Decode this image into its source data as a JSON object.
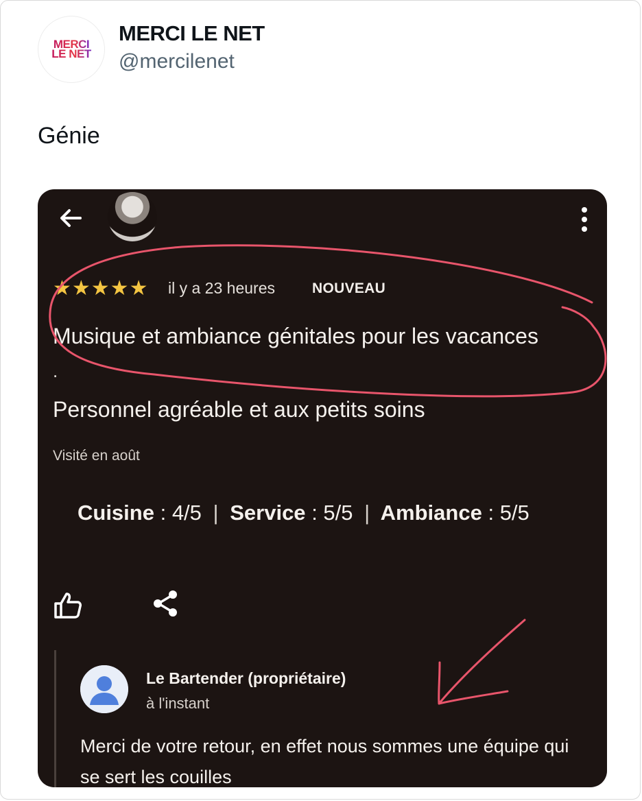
{
  "tweet": {
    "display_name": "MERCI LE NET",
    "handle": "@mercilenet",
    "text": "Génie",
    "avatar_logo_lines": [
      "MERCI",
      "LE NET"
    ]
  },
  "review": {
    "stars": "★★★★★",
    "rating": 5,
    "time": "il y a 23 heures",
    "badge": "NOUVEAU",
    "line1": "Musique et ambiance génitales pour les vacances",
    "dot": ".",
    "line2": "Personnel agréable et aux petits soins",
    "visited": "Visité en août",
    "ratings": [
      {
        "label": "Cuisine",
        "value": ": 4/5"
      },
      {
        "label": "Service",
        "value": ": 5/5"
      },
      {
        "label": "Ambiance",
        "value": ": 5/5"
      }
    ],
    "separator": "|"
  },
  "reply": {
    "author": "Le Bartender (propriétaire)",
    "time": "à l'instant",
    "text": "Merci de votre retour, en effet nous sommes une équipe qui se sert les couilles"
  },
  "colors": {
    "media_bg": "#1c1412",
    "annotation": "#e8556b",
    "star": "#f4c542",
    "owner_avatar": "#4f7fdc"
  },
  "icons": [
    "back-arrow-icon",
    "more-vertical-icon",
    "thumbs-up-icon",
    "share-icon",
    "person-icon"
  ]
}
